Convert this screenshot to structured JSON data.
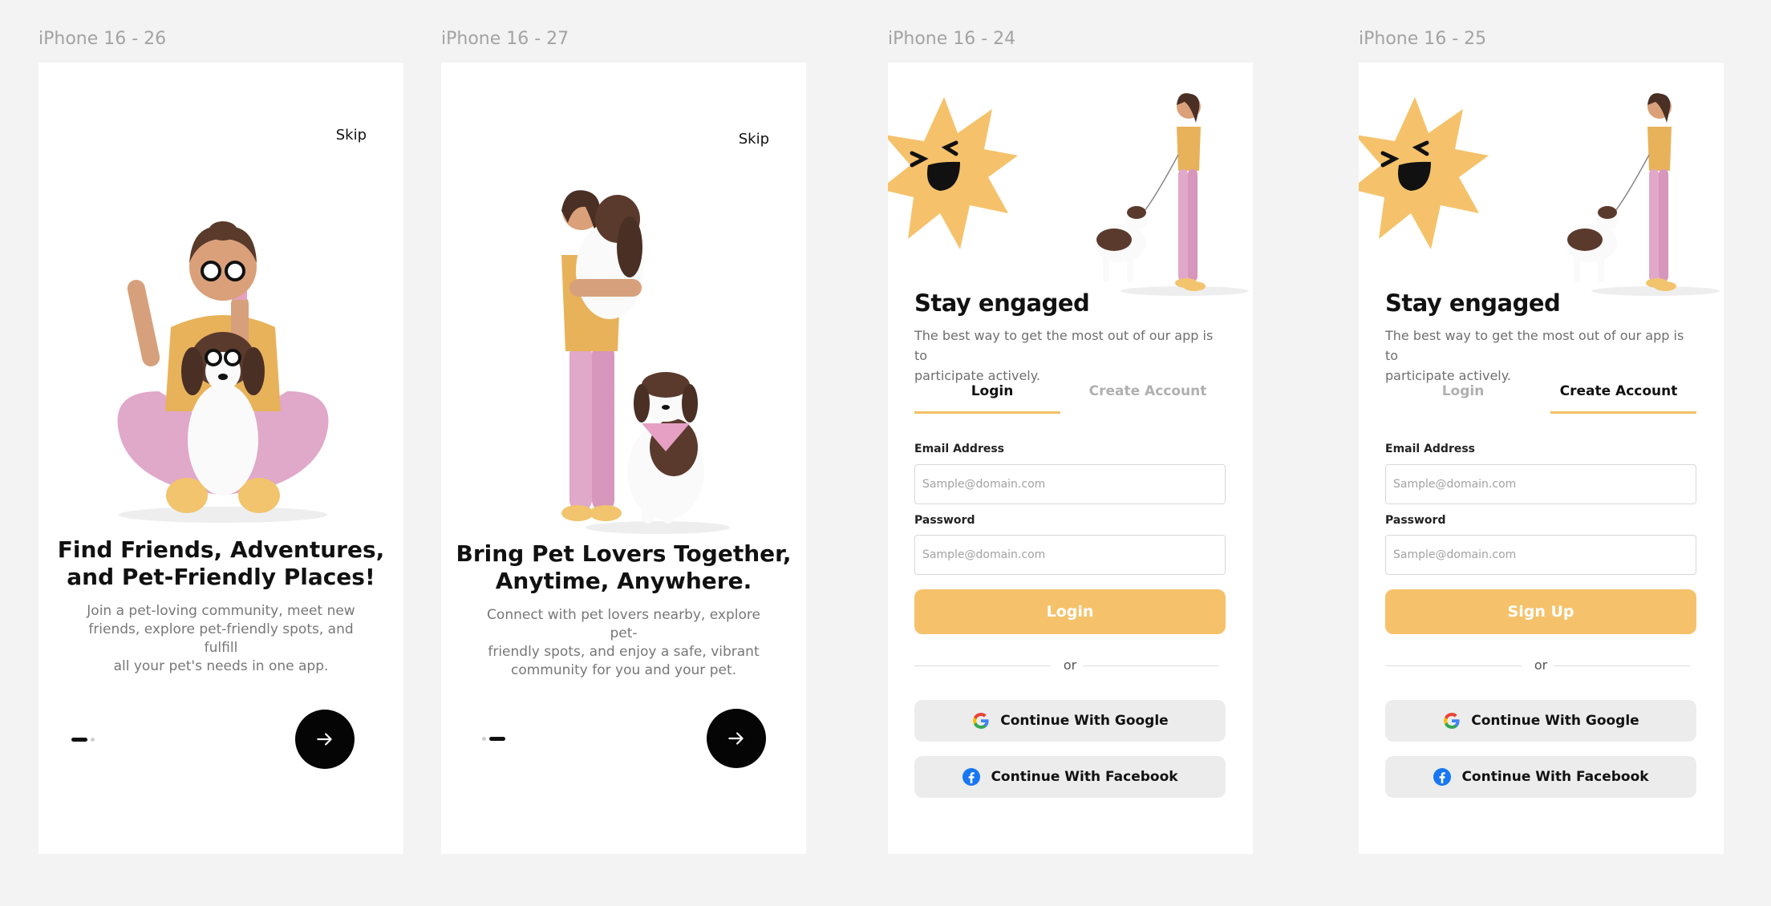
{
  "frames": [
    {
      "label": "iPhone 16 - 26",
      "skip": "Skip",
      "title_line1": "Find Friends, Adventures,",
      "title_line2": "and Pet-Friendly Places!",
      "sub_line1": "Join a pet-loving community, meet new",
      "sub_line2": "friends, explore pet-friendly spots, and fulfill",
      "sub_line3": "all your pet's needs in one app.",
      "page_indicator": {
        "current": 1,
        "total": 2
      }
    },
    {
      "label": "iPhone 16 - 27",
      "skip": "Skip",
      "title_line1": "Bring Pet Lovers Together,",
      "title_line2": "Anytime, Anywhere.",
      "sub_line1": "Connect with pet lovers nearby, explore pet-",
      "sub_line2": "friendly spots, and enjoy a safe, vibrant",
      "sub_line3": "community for you and your pet.",
      "page_indicator": {
        "current": 2,
        "total": 2
      }
    },
    {
      "label": "iPhone 16 - 24",
      "title": "Stay engaged",
      "sub_line1": "The best way to get the most out of our app is to",
      "sub_line2": "participate actively.",
      "tab_login": "Login",
      "tab_create": "Create Account",
      "active_tab": "Login",
      "email_label": "Email Address",
      "email_placeholder": "Sample@domain.com",
      "password_label": "Password",
      "password_placeholder": "Sample@domain.com",
      "primary": "Login",
      "or": "or",
      "google": "Continue With Google",
      "facebook": "Continue With Facebook"
    },
    {
      "label": "iPhone 16 - 25",
      "title": "Stay engaged",
      "sub_line1": "The best way to get the most out of our app is to",
      "sub_line2": "participate actively.",
      "tab_login": "Login",
      "tab_create": "Create Account",
      "active_tab": "Create Account",
      "email_label": "Email Address",
      "email_placeholder": "Sample@domain.com",
      "password_label": "Password",
      "password_placeholder": "Sample@domain.com",
      "primary": "Sign Up",
      "or": "or",
      "google": "Continue With Google",
      "facebook": "Continue With Facebook"
    }
  ],
  "colors": {
    "canvas": "#f3f3f3",
    "accent": "#f5c26b",
    "tab_underline": "#f2bf66",
    "dark": "#050505",
    "social_bg": "#ececec",
    "facebook": "#1877f2"
  }
}
